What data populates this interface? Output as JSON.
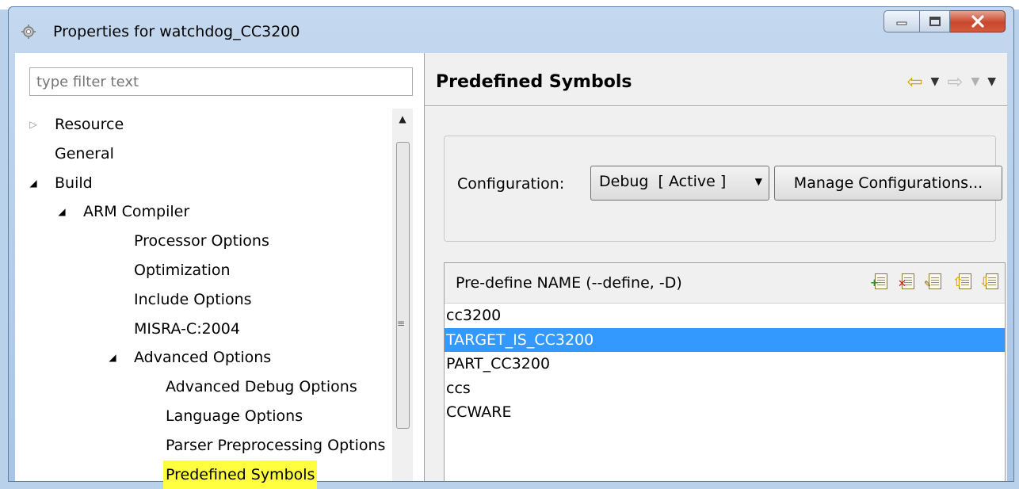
{
  "window": {
    "title": "Properties for watchdog_CC3200"
  },
  "filter": {
    "placeholder": "type filter text"
  },
  "tree": [
    {
      "label": "Resource",
      "level": 0,
      "state": "collapsed"
    },
    {
      "label": "General",
      "level": 0,
      "state": "leaf"
    },
    {
      "label": "Build",
      "level": 0,
      "state": "expanded"
    },
    {
      "label": "ARM Compiler",
      "level": 1,
      "state": "expanded"
    },
    {
      "label": "Processor Options",
      "level": 2,
      "state": "leaf"
    },
    {
      "label": "Optimization",
      "level": 2,
      "state": "leaf"
    },
    {
      "label": "Include Options",
      "level": 2,
      "state": "leaf"
    },
    {
      "label": "MISRA-C:2004",
      "level": 2,
      "state": "leaf"
    },
    {
      "label": "Advanced Options",
      "level": 2,
      "state": "expanded"
    },
    {
      "label": "Advanced Debug Options",
      "level": 3,
      "state": "leaf"
    },
    {
      "label": "Language Options",
      "level": 3,
      "state": "leaf"
    },
    {
      "label": "Parser Preprocessing Options",
      "level": 3,
      "state": "leaf"
    },
    {
      "label": "Predefined Symbols",
      "level": 3,
      "state": "leaf",
      "highlighted": true
    }
  ],
  "page": {
    "title": "Predefined Symbols"
  },
  "configuration": {
    "label": "Configuration:",
    "selected": "Debug  [ Active ]",
    "manage_button": "Manage Configurations..."
  },
  "symbols": {
    "header": "Pre-define NAME (--define, -D)",
    "items": [
      "cc3200",
      "TARGET_IS_CC3200",
      "PART_CC3200",
      "ccs",
      "CCWARE"
    ],
    "selected_index": 1,
    "tools": [
      "add-icon",
      "delete-icon",
      "edit-icon",
      "move-up-icon",
      "move-down-icon"
    ]
  },
  "colors": {
    "selection": "#3399ff",
    "highlight": "#ffff40"
  }
}
